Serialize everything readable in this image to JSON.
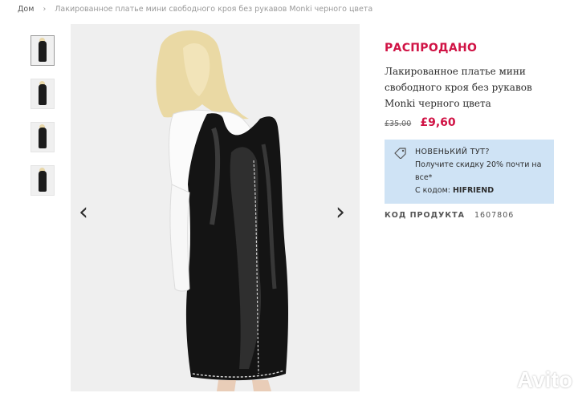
{
  "breadcrumb": {
    "home": "Дом",
    "separator": "›",
    "current": "Лакированное платье мини свободного кроя без рукавов Monki черного цвета"
  },
  "thumbnails": [
    {
      "name": "thumb-1"
    },
    {
      "name": "thumb-2"
    },
    {
      "name": "thumb-3"
    },
    {
      "name": "thumb-4"
    }
  ],
  "gallery": {
    "prev_arrow": "‹",
    "next_arrow": "›"
  },
  "product": {
    "sale_label": "РАСПРОДАНО",
    "title": "Лакированное платье мини свободного кроя без рукавов Monki черного цвета",
    "old_price": "£35.00",
    "new_price": "£9,60"
  },
  "promo": {
    "icon": "tag-icon",
    "title": "НОВЕНЬКИЙ ТУТ?",
    "text": "Получите скидку 20% почти на все*",
    "code_prefix": "С кодом: ",
    "code": "HIFRIEND"
  },
  "product_code": {
    "label": "КОД ПРОДУКТА",
    "value": "1607806"
  },
  "watermark": {
    "text": "Avito"
  },
  "colors": {
    "accent": "#d01345",
    "promo_bg": "#cfe3f5",
    "text": "#2d2d2d"
  }
}
